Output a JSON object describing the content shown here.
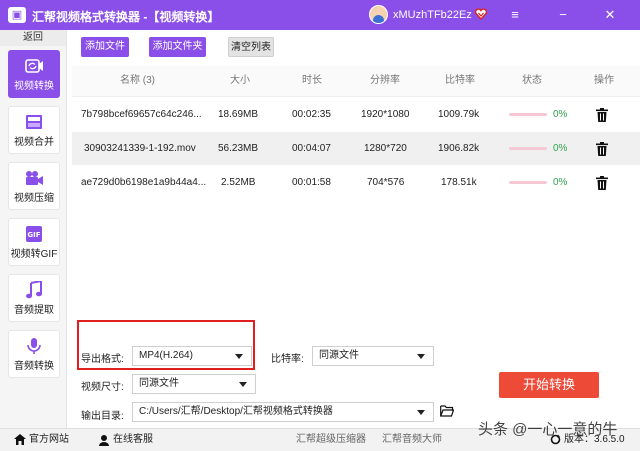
{
  "titlebar": {
    "app_title": "汇帮视频格式转换器 -【视频转换】",
    "username": "xMUzhTFb22Ez",
    "vip_icon": "vip-heart-icon",
    "logo_icon": "app-logo-icon",
    "accent": "#8a4fe8"
  },
  "sidebar": {
    "back_label": "返回",
    "items": [
      {
        "label": "视频转换",
        "icon": "video-convert-icon"
      },
      {
        "label": "视频合并",
        "icon": "video-merge-icon"
      },
      {
        "label": "视频压缩",
        "icon": "video-compress-icon"
      },
      {
        "label": "视频转GIF",
        "icon": "gif-icon"
      },
      {
        "label": "音频提取",
        "icon": "music-note-icon"
      },
      {
        "label": "音频转换",
        "icon": "microphone-icon"
      }
    ]
  },
  "toolbar": {
    "add_file": "添加文件",
    "add_folder": "添加文件夹",
    "clear_list": "清空列表"
  },
  "table": {
    "headers": {
      "name": "名称 (3)",
      "size": "大小",
      "duration": "时长",
      "resolution": "分辨率",
      "bitrate": "比特率",
      "status": "状态",
      "action": "操作"
    },
    "rows": [
      {
        "name": "7b798bcef69657c64c246...",
        "size": "18.69MB",
        "duration": "00:02:35",
        "resolution": "1920*1080",
        "bitrate": "1009.79k",
        "progress": "0%"
      },
      {
        "name": "30903241339-1-192.mov",
        "size": "56.23MB",
        "duration": "00:04:07",
        "resolution": "1280*720",
        "bitrate": "1906.82k",
        "progress": "0%"
      },
      {
        "name": "ae729d0b6198e1a9b44a4...",
        "size": "2.52MB",
        "duration": "00:01:58",
        "resolution": "704*576",
        "bitrate": "178.51k",
        "progress": "0%"
      }
    ]
  },
  "settings": {
    "format_label": "导出格式:",
    "format_value": "MP4(H.264)",
    "bitrate_label": "比特率:",
    "bitrate_value": "同源文件",
    "size_label": "视频尺寸:",
    "size_value": "同源文件",
    "output_label": "输出目录:",
    "output_value": "C:/Users/汇帮/Desktop/汇帮视频格式转换器",
    "start_button": "开始转换"
  },
  "footer": {
    "website": "官方网站",
    "support": "在线客服",
    "link1": "汇帮超级压缩器",
    "link2": "汇帮音频大师",
    "version": "版本：3.6.5.0"
  },
  "watermark": "头条 @一心一意的牛"
}
